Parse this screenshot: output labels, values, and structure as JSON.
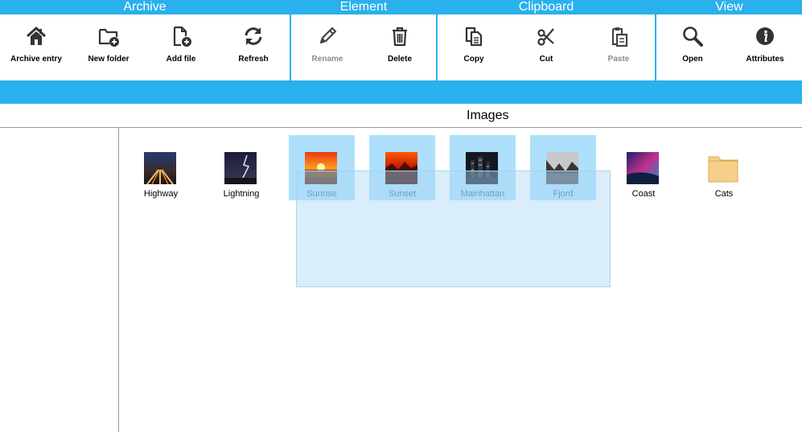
{
  "ribbon": {
    "groups": {
      "archive": {
        "title": "Archive",
        "archive_entry": "Archive entry",
        "new_folder": "New folder",
        "add_file": "Add file",
        "refresh": "Refresh"
      },
      "element": {
        "title": "Element",
        "rename": "Rename",
        "delete": "Delete"
      },
      "clipboard": {
        "title": "Clipboard",
        "copy": "Copy",
        "cut": "Cut",
        "paste": "Paste"
      },
      "view": {
        "title": "View",
        "open": "Open",
        "attributes": "Attributes"
      }
    },
    "disabled": [
      "Rename",
      "Paste"
    ]
  },
  "folder": {
    "title": "Images",
    "items": [
      {
        "name": "Highway",
        "type": "image",
        "selected": false
      },
      {
        "name": "Lightning",
        "type": "image",
        "selected": false
      },
      {
        "name": "Sunrise",
        "type": "image",
        "selected": true
      },
      {
        "name": "Sunset",
        "type": "image",
        "selected": true
      },
      {
        "name": "Mainhattan",
        "type": "image",
        "selected": true
      },
      {
        "name": "Fjord",
        "type": "image",
        "selected": true
      },
      {
        "name": "Coast",
        "type": "image",
        "selected": false
      },
      {
        "name": "Cats",
        "type": "folder",
        "selected": false
      }
    ]
  },
  "colors": {
    "ribbon": "#2ab0ec",
    "selection": "#aee0fb",
    "folder": "#f6d08a"
  }
}
